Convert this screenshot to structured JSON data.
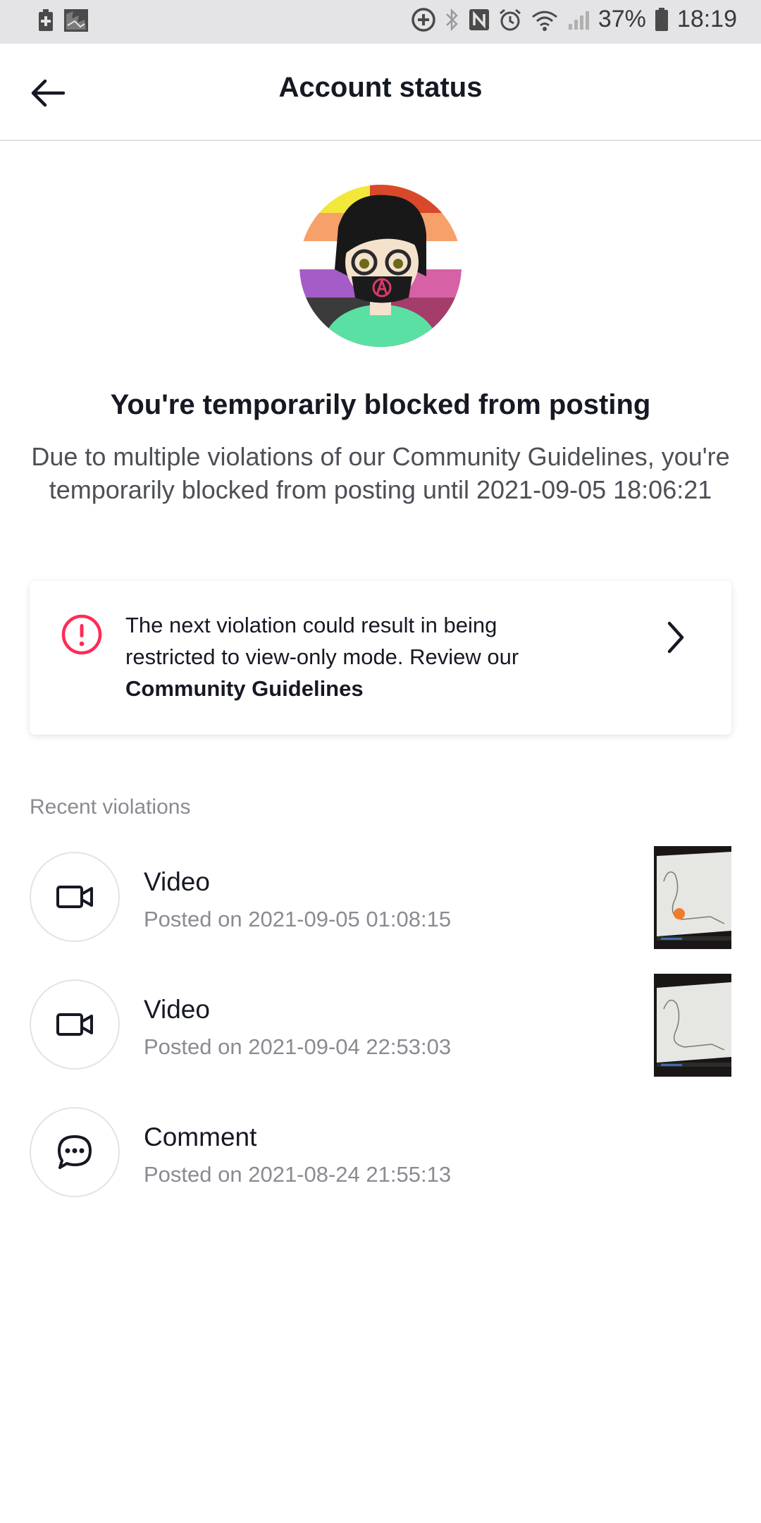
{
  "status_bar": {
    "battery_percent": "37%",
    "time": "18:19",
    "left_icons": [
      "battery-saver-icon",
      "photo-notification-icon"
    ],
    "right_icons": [
      "data-saver-icon",
      "bluetooth-icon",
      "nfc-icon",
      "alarm-icon",
      "wifi-icon",
      "signal-icon",
      "battery-icon"
    ]
  },
  "header": {
    "title": "Account status",
    "back_icon": "arrow-left-icon"
  },
  "status": {
    "headline": "You're temporarily blocked from posting",
    "description": "Due to multiple violations of our Community Guidelines, you're temporarily blocked from posting until 2021-09-05 18:06:21"
  },
  "warning_card": {
    "text": "The next violation could result in being restricted to view-only mode. Review our",
    "link": "Community Guidelines",
    "icon": "alert-circle-icon",
    "chevron_icon": "chevron-right-icon",
    "accent_color": "#fe2c55"
  },
  "violations": {
    "section_label": "Recent violations",
    "items": [
      {
        "type": "Video",
        "posted": "Posted on 2021-09-05 01:08:15",
        "icon": "video-camera-icon",
        "has_thumbnail": true
      },
      {
        "type": "Video",
        "posted": "Posted on 2021-09-04 22:53:03",
        "icon": "video-camera-icon",
        "has_thumbnail": true
      },
      {
        "type": "Comment",
        "posted": "Posted on 2021-08-24 21:55:13",
        "icon": "comment-bubble-icon",
        "has_thumbnail": false
      }
    ]
  }
}
